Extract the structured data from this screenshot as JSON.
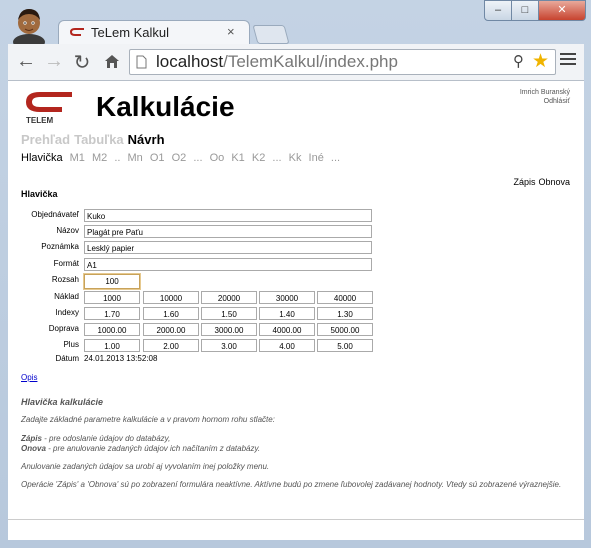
{
  "browser": {
    "tab_title": "TeLem Kalkul",
    "tab_close": "×",
    "url_host": "localhost",
    "url_path": "/TelemKalkul/index.php",
    "win_min": "–",
    "win_max": "□",
    "win_close": "✕"
  },
  "header": {
    "logo_text": "TELEM",
    "title": "Kalkulácie",
    "user_name": "Imrich Buranský",
    "logout": "Odhlásiť"
  },
  "nav_main": [
    {
      "label": "Prehľad",
      "active": false
    },
    {
      "label": "Tabuľka",
      "active": false
    },
    {
      "label": "Návrh",
      "active": true
    }
  ],
  "nav_sub": [
    "Hlavička",
    "M1",
    "M2",
    "..",
    "Mn",
    "O1",
    "O2",
    "...",
    "Oo",
    "K1",
    "K2",
    "...",
    "Kk",
    "Iné",
    "..."
  ],
  "actions": {
    "save": "Zápis",
    "restore": "Obnova"
  },
  "section_title": "Hlavička",
  "form": {
    "labels": {
      "customer": "Objednávateľ",
      "name": "Názov",
      "note": "Poznámka",
      "format": "Formát",
      "range": "Rozsah",
      "cost": "Náklad",
      "index": "Indexy",
      "transport": "Doprava",
      "plus": "Plus",
      "date": "Dátum"
    },
    "customer": "Kuko",
    "name": "Plagát pre Paťu",
    "note": "Lesklý papier",
    "format": "A1",
    "range": "100",
    "cost": [
      "1000",
      "10000",
      "20000",
      "30000",
      "40000"
    ],
    "index": [
      "1.70",
      "1.60",
      "1.50",
      "1.40",
      "1.30"
    ],
    "transport": [
      "1000.00",
      "2000.00",
      "3000.00",
      "4000.00",
      "5000.00"
    ],
    "plus": [
      "1.00",
      "2.00",
      "3.00",
      "4.00",
      "5.00"
    ],
    "date": "24.01.2013 13:52:08"
  },
  "opis_link": "Opis",
  "help": {
    "title": "Hlavička kalkulácie",
    "p1": "Zadajte základné parametre kalkulácie a v pravom hornom rohu stlačte:",
    "p2a_b": "Zápis",
    "p2a": " - pre odoslanie údajov do databázy,",
    "p2b_b": "Onova",
    "p2b": " - pre anulovanie zadaných údajov ich načítaním z databázy.",
    "p3": "Anulovanie zadaných údajov sa urobí aj vyvolaním inej položky menu.",
    "p4": "Operácie 'Zápis' a 'Obnova' sú po zobrazení formulára neaktívne. Aktívne budú po zmene ľubovolej zadávanej hodnoty. Vtedy sú zobrazené výraznejšie."
  },
  "colors": {
    "logo_red": "#b3261e",
    "link": "#0000cc"
  }
}
